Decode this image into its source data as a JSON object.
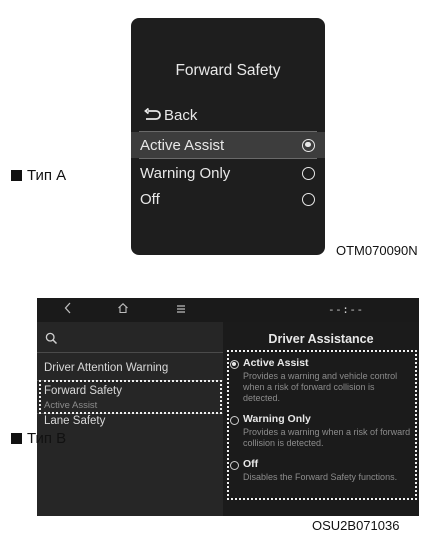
{
  "panel_a": {
    "title": "Forward Safety",
    "back_label": "Back",
    "options": [
      {
        "label": "Active Assist",
        "selected": true
      },
      {
        "label": "Warning Only",
        "selected": false
      },
      {
        "label": "Off",
        "selected": false
      }
    ],
    "type_label": "Тип A",
    "code": "OTM070090N"
  },
  "panel_b": {
    "status_time": "--:--",
    "status_icons": [
      "back-chevron-icon",
      "home-icon",
      "menu-icon"
    ],
    "menu": [
      {
        "label": "Driver Attention Warning"
      },
      {
        "label": "Forward Safety",
        "sub": "Active Assist"
      },
      {
        "label": "Lane Safety"
      }
    ],
    "right_title": "Driver Assistance",
    "options": [
      {
        "label": "Active Assist",
        "desc": "Provides a warning and vehicle control when a risk of forward collision is detected.",
        "selected": true
      },
      {
        "label": "Warning Only",
        "desc": "Provides a warning when a risk of forward collision is detected.",
        "selected": false
      },
      {
        "label": "Off",
        "desc": "Disables the Forward Safety functions.",
        "selected": false
      }
    ],
    "type_label": "Тип B",
    "code": "OSU2B071036"
  },
  "colors": {
    "screen_bg": "#1e1e1e",
    "selected_row": "#3d3d3d",
    "text_light": "#e8e8e8",
    "text_dim": "#8c8c8c"
  }
}
